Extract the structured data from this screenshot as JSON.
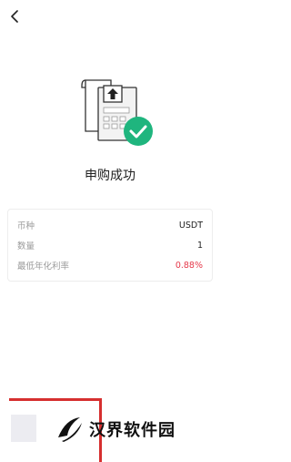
{
  "nav": {
    "back_icon": "chevron-left-icon"
  },
  "result": {
    "illustration_icon": "receipt-upload-check-icon",
    "title": "申购成功",
    "accent_color": "#1fb57e"
  },
  "details": {
    "rows": [
      {
        "label": "币种",
        "value": "USDT"
      },
      {
        "label": "数量",
        "value": "1"
      },
      {
        "label": "最低年化利率",
        "value": "0.88%"
      }
    ],
    "rate_color": "#e5394a"
  },
  "watermark": {
    "text": "汉界软件园"
  }
}
